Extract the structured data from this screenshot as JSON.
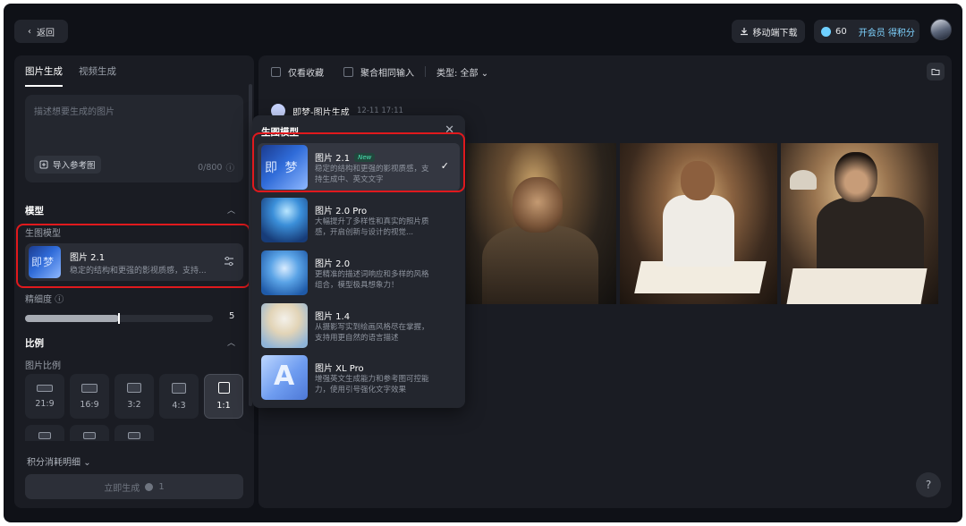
{
  "header": {
    "back_label": "返回",
    "download_label": "移动端下载",
    "credits": "60",
    "vip_label": "开会员 得积分"
  },
  "left": {
    "tabs": [
      "图片生成",
      "视频生成"
    ],
    "prompt_placeholder": "描述想要生成的图片",
    "import_ref_label": "导入参考图",
    "char_counter": "0/800",
    "model_section": "模型",
    "model_sub_label": "生图模型",
    "selected_model": {
      "name": "图片 2.1",
      "desc": "稳定的结构和更强的影视质感，支持..."
    },
    "detail_label": "精细度",
    "detail_value": "5",
    "detail_fraction": 0.5,
    "ratio_section": "比例",
    "ratio_sub_label": "图片比例",
    "ratios": [
      "21:9",
      "16:9",
      "3:2",
      "4:3",
      "1:1"
    ],
    "selected_ratio": "1:1",
    "cost_detail_label": "积分消耗明细",
    "generate_label": "立即生成",
    "generate_cost": "1"
  },
  "main": {
    "filters": {
      "favorites": "仅看收藏",
      "merge": "聚合相同输入",
      "type": "类型: 全部"
    },
    "task_title": "即梦-图片生成",
    "task_time": "12-11 17:11"
  },
  "dropdown": {
    "title": "生图模型",
    "items": [
      {
        "name": "图片 2.1",
        "badge": "New",
        "desc": "稳定的结构和更强的影视质感，支持生成中、英文文字",
        "selected": true,
        "thumb_glyph": "即 梦"
      },
      {
        "name": "图片 2.0 Pro",
        "desc": "大幅提升了多样性和真实的照片质感，开启创新与设计的视觉..."
      },
      {
        "name": "图片 2.0",
        "desc": "更精准的描述词响应和多样的风格组合，模型极具想象力！"
      },
      {
        "name": "图片 1.4",
        "desc": "从摄影写实到绘画风格尽在掌握，支持用更自然的语言描述"
      },
      {
        "name": "图片 XL Pro",
        "desc": "增强英文生成能力和参考图可控能力，使用引号强化文字效果",
        "thumb_glyph": "A"
      }
    ]
  },
  "colors": {
    "highlight_box": "#e0191d",
    "accent": "#7fd3ff",
    "new_badge": "#4be6b5"
  }
}
